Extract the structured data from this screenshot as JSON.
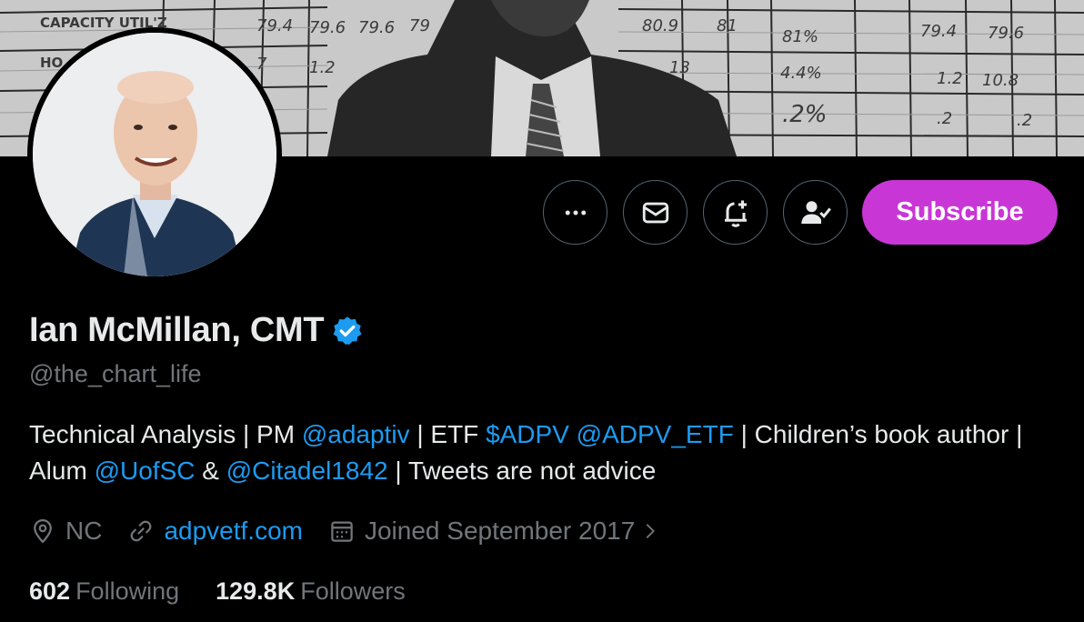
{
  "banner": {
    "capacity_label": "CAPACITY UTIL'Z",
    "row_label": "HO",
    "cells_row1": [
      "79.4",
      "79.6",
      "79.6",
      "79",
      "80.9",
      "81",
      "81%",
      "79.4",
      "79.6"
    ],
    "cells_row2": [
      "7",
      "1.2",
      "13",
      "4.4%",
      "1.2",
      "10.8"
    ],
    "cells_row3": [
      ".2%",
      ".2",
      ".2"
    ]
  },
  "profile": {
    "display_name": "Ian McMillan, CMT",
    "handle": "@the_chart_life"
  },
  "actions": {
    "more_icon": "ellipsis-icon",
    "message_icon": "envelope-icon",
    "notify_icon": "bell-plus-icon",
    "following_icon": "person-check-icon",
    "subscribe_label": "Subscribe",
    "subscribe_color": "#c936d6"
  },
  "bio": {
    "t1": "Technical Analysis | PM ",
    "m1": "@adaptiv",
    "t2": " | ETF ",
    "c1": "$ADPV",
    "t3": " ",
    "m2": "@ADPV_ETF",
    "t4": " | Children’s book author | Alum ",
    "m3": "@UofSC",
    "t5": " & ",
    "m4": "@Citadel1842",
    "t6": " | Tweets are not advice"
  },
  "meta": {
    "location": "NC",
    "website": "adpvetf.com",
    "joined": "Joined September 2017"
  },
  "stats": {
    "following_count": "602",
    "following_label": "Following",
    "followers_count": "129.8K",
    "followers_label": "Followers"
  },
  "colors": {
    "accent_link": "#1d9bf0",
    "secondary_text": "#71767b",
    "primary_text": "#e7e9ea",
    "background": "#000000"
  }
}
